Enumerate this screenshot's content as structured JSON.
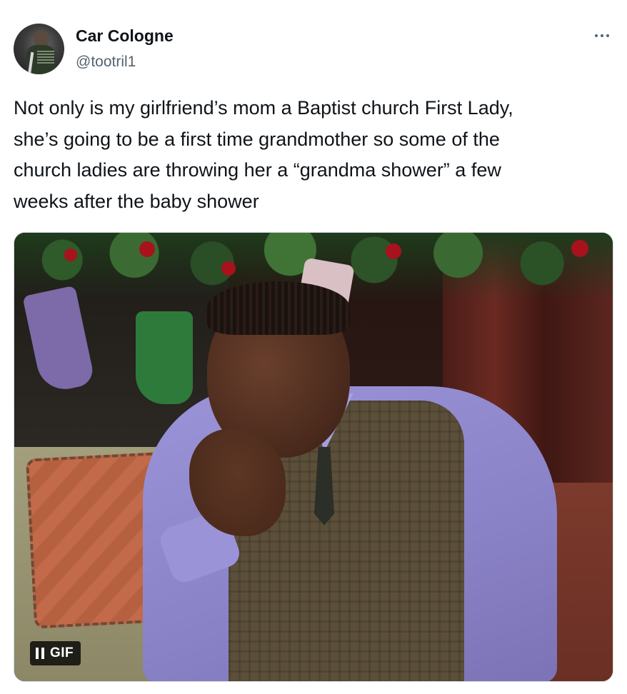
{
  "author": {
    "display_name": "Car Cologne",
    "handle": "@tootril1"
  },
  "tweet": {
    "text": "Not only is my girlfriend’s mom a Baptist church First Lady,\nshe’s going to be a first time grandmother so some of the\nchurch ladies are throwing her a “grandma shower” a few\nweeks after the baby shower"
  },
  "media": {
    "type": "gif",
    "badge_label": "GIF",
    "control_icon": "pause-icon"
  },
  "icons": {
    "more": "more-options-icon"
  },
  "colors": {
    "text_primary": "#0f1419",
    "text_secondary": "#536471",
    "border": "#cfd9de",
    "badge_bg": "#000000"
  }
}
